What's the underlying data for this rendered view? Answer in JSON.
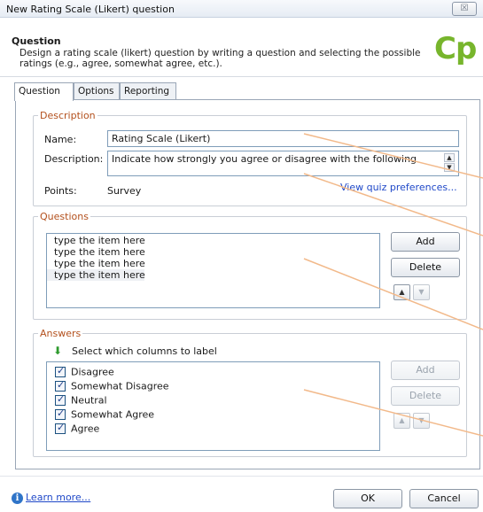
{
  "window": {
    "title": "New Rating Scale (Likert) question",
    "close_symbol": "☒"
  },
  "header": {
    "title": "Question",
    "description": "Design a rating scale (likert) question by writing a question and selecting the possible ratings (e.g., agree, somewhat agree, etc.).",
    "logo_text": "Cp",
    "logo_color": "#77b52c"
  },
  "tabs": [
    {
      "label": "Question",
      "active": true
    },
    {
      "label": "Options",
      "active": false
    },
    {
      "label": "Reporting",
      "active": false
    }
  ],
  "description_group": {
    "legend": "Description",
    "name_label": "Name:",
    "name_value": "Rating Scale (Likert)",
    "description_label": "Description:",
    "description_value": "Indicate how strongly you agree or disagree with the following",
    "points_label": "Points:",
    "points_value": "Survey",
    "quiz_prefs_link": "View quiz preferences..."
  },
  "questions_group": {
    "legend": "Questions",
    "items": [
      "type the item here",
      "type the item here",
      "type the item here",
      "type the item here"
    ],
    "add_label": "Add",
    "delete_label": "Delete"
  },
  "answers_group": {
    "legend": "Answers",
    "select_columns_label": "Select which columns to label",
    "items": [
      {
        "label": "Disagree",
        "checked": true
      },
      {
        "label": "Somewhat Disagree",
        "checked": true
      },
      {
        "label": "Neutral",
        "checked": true
      },
      {
        "label": "Somewhat Agree",
        "checked": true
      },
      {
        "label": "Agree",
        "checked": true
      }
    ],
    "add_label": "Add",
    "delete_label": "Delete"
  },
  "footer": {
    "learn_more": "Learn more...",
    "ok_label": "OK",
    "cancel_label": "Cancel"
  },
  "colors": {
    "legend_text": "#b3501d",
    "link": "#1f48c8",
    "callout_line": "#f2b98a"
  }
}
